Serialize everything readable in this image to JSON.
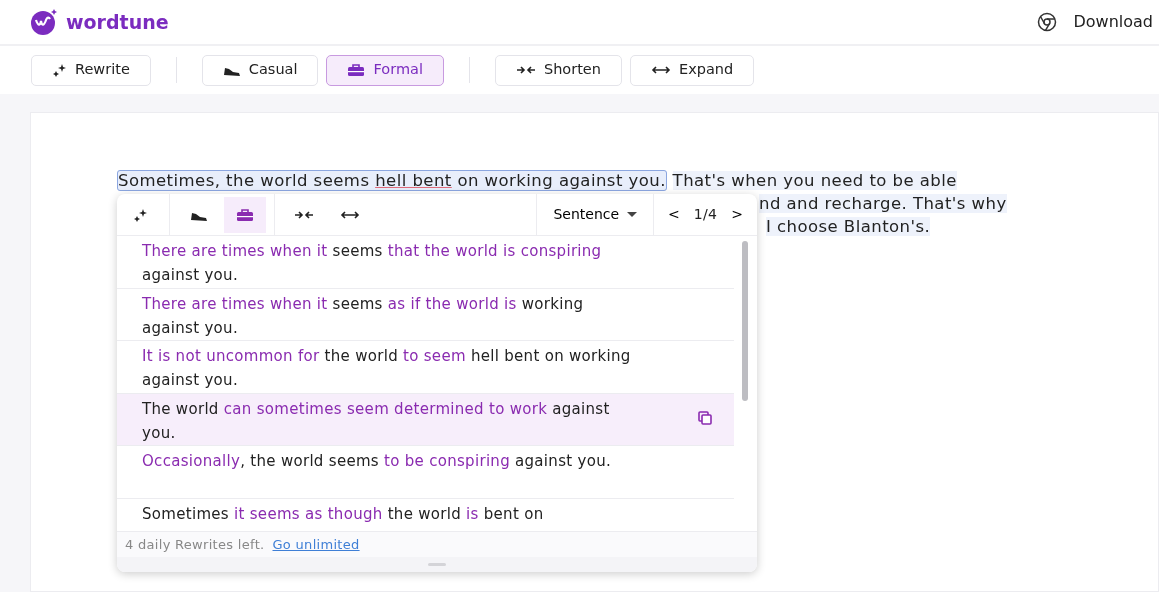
{
  "header": {
    "brand": "wordtune",
    "download": "Download"
  },
  "toolbar": {
    "groups": [
      [
        {
          "kind": "rewrite",
          "label": "Rewrite",
          "selected": false
        }
      ],
      [
        {
          "kind": "casual",
          "label": "Casual",
          "selected": false
        },
        {
          "kind": "formal",
          "label": "Formal",
          "selected": true
        }
      ],
      [
        {
          "kind": "shorten",
          "label": "Shorten",
          "selected": false
        },
        {
          "kind": "expand",
          "label": "Expand",
          "selected": false
        }
      ]
    ]
  },
  "document": {
    "sentence": [
      {
        "text": "Sometimes, the world seems ",
        "flagged": false
      },
      {
        "text": "hell bent",
        "flagged": true
      },
      {
        "text": " on working against you.",
        "flagged": false
      }
    ],
    "lines": [
      "That's when you need to be able",
      "nd and recharge. That's why",
      "I choose Blanton's."
    ]
  },
  "popup": {
    "groups": [
      [
        {
          "kind": "rewrite",
          "selected": false
        }
      ],
      [
        {
          "kind": "casual",
          "selected": false
        },
        {
          "kind": "formal",
          "selected": true
        }
      ],
      [
        {
          "kind": "shorten",
          "selected": false
        },
        {
          "kind": "expand",
          "selected": false
        }
      ]
    ],
    "scope": "Sentence",
    "prev": "<",
    "page": "1/4",
    "next": ">",
    "suggestions": [
      {
        "selected": false,
        "segments": [
          {
            "text": "There are times when it",
            "changed": true
          },
          {
            "text": " seems ",
            "changed": false
          },
          {
            "text": "that the world is conspiring",
            "changed": true
          },
          {
            "text": " against you.",
            "changed": false
          }
        ]
      },
      {
        "selected": false,
        "segments": [
          {
            "text": "There are times when it",
            "changed": true
          },
          {
            "text": " seems ",
            "changed": false
          },
          {
            "text": "as if the world is",
            "changed": true
          },
          {
            "text": " working against you.",
            "changed": false
          }
        ]
      },
      {
        "selected": false,
        "segments": [
          {
            "text": "It is not uncommon for",
            "changed": true
          },
          {
            "text": " the world ",
            "changed": false
          },
          {
            "text": "to seem",
            "changed": true
          },
          {
            "text": " hell bent on working against you.",
            "changed": false
          }
        ]
      },
      {
        "selected": true,
        "segments": [
          {
            "text": "The world ",
            "changed": false
          },
          {
            "text": "can sometimes seem determined to work",
            "changed": true
          },
          {
            "text": " against you.",
            "changed": false
          }
        ]
      },
      {
        "selected": false,
        "segments": [
          {
            "text": "Occasionally",
            "changed": true
          },
          {
            "text": ", the world seems ",
            "changed": false
          },
          {
            "text": "to be conspiring",
            "changed": true
          },
          {
            "text": " against you.",
            "changed": false
          }
        ]
      },
      {
        "selected": false,
        "segments": [
          {
            "text": "Sometimes ",
            "changed": false
          },
          {
            "text": "it seems as though",
            "changed": true
          },
          {
            "text": " the world ",
            "changed": false
          },
          {
            "text": "is",
            "changed": true
          },
          {
            "text": " bent on",
            "changed": false
          }
        ]
      }
    ],
    "footer": {
      "note": "4 daily Rewrites left.",
      "link": "Go unlimited"
    }
  }
}
